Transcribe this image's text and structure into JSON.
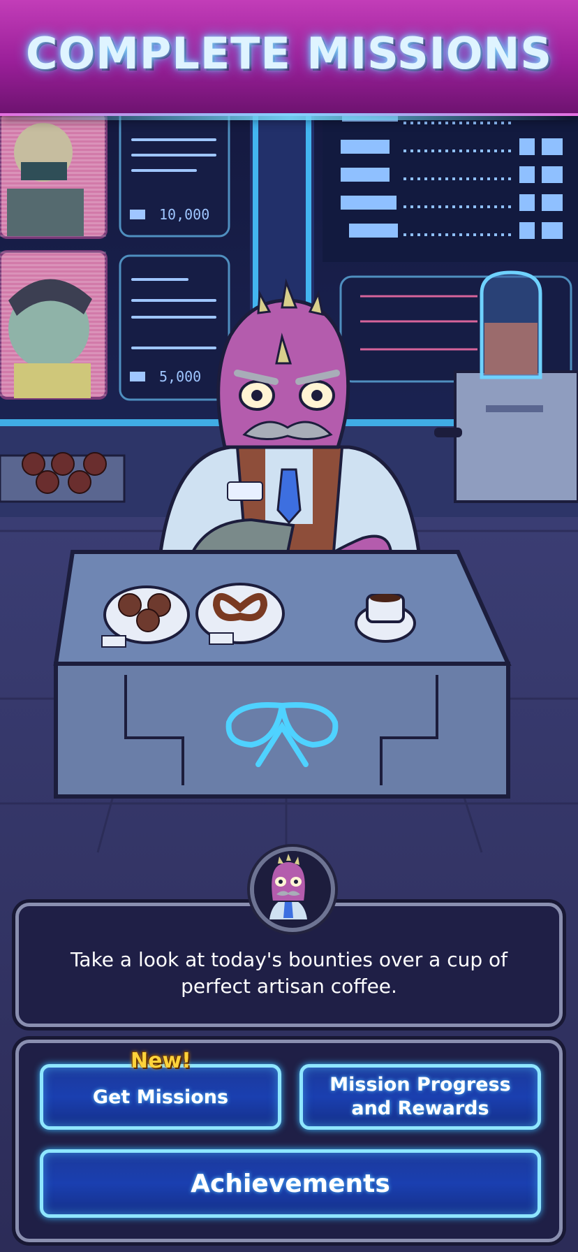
{
  "banner": {
    "title": "COMPLETE MISSIONS"
  },
  "background": {
    "bounty_board_1": {
      "reward": "10,000"
    },
    "bounty_board_2": {
      "reward": "5,000"
    }
  },
  "dialog": {
    "text": "Take a look at today's bounties over a cup of perfect artisan coffee."
  },
  "buttons": {
    "new_badge": "New!",
    "get_missions": "Get Missions",
    "mission_progress_line1": "Mission Progress",
    "mission_progress_line2": "and Rewards",
    "achievements": "Achievements"
  },
  "colors": {
    "banner": "#9a1f99",
    "button_fill": "#1a3fb0",
    "button_border": "#8fe6ff",
    "new_badge": "#ffd23a",
    "dialog_bg": "#1f1f46"
  }
}
